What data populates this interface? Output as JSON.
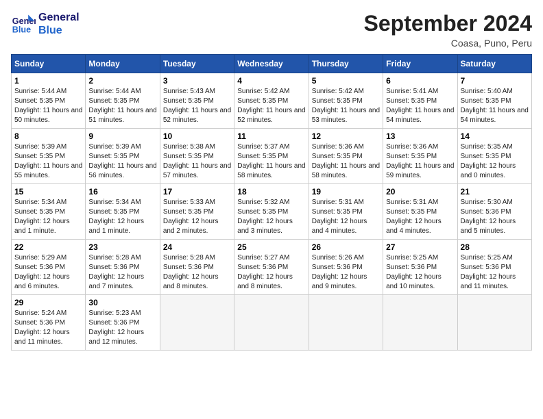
{
  "header": {
    "logo_general": "General",
    "logo_blue": "Blue",
    "month_title": "September 2024",
    "location": "Coasa, Puno, Peru"
  },
  "calendar": {
    "days_of_week": [
      "Sunday",
      "Monday",
      "Tuesday",
      "Wednesday",
      "Thursday",
      "Friday",
      "Saturday"
    ],
    "weeks": [
      [
        {
          "day": "1",
          "sunrise": "5:44 AM",
          "sunset": "5:35 PM",
          "daylight": "11 hours and 50 minutes."
        },
        {
          "day": "2",
          "sunrise": "5:44 AM",
          "sunset": "5:35 PM",
          "daylight": "11 hours and 51 minutes."
        },
        {
          "day": "3",
          "sunrise": "5:43 AM",
          "sunset": "5:35 PM",
          "daylight": "11 hours and 52 minutes."
        },
        {
          "day": "4",
          "sunrise": "5:42 AM",
          "sunset": "5:35 PM",
          "daylight": "11 hours and 52 minutes."
        },
        {
          "day": "5",
          "sunrise": "5:42 AM",
          "sunset": "5:35 PM",
          "daylight": "11 hours and 53 minutes."
        },
        {
          "day": "6",
          "sunrise": "5:41 AM",
          "sunset": "5:35 PM",
          "daylight": "11 hours and 54 minutes."
        },
        {
          "day": "7",
          "sunrise": "5:40 AM",
          "sunset": "5:35 PM",
          "daylight": "11 hours and 54 minutes."
        }
      ],
      [
        {
          "day": "8",
          "sunrise": "5:39 AM",
          "sunset": "5:35 PM",
          "daylight": "11 hours and 55 minutes."
        },
        {
          "day": "9",
          "sunrise": "5:39 AM",
          "sunset": "5:35 PM",
          "daylight": "11 hours and 56 minutes."
        },
        {
          "day": "10",
          "sunrise": "5:38 AM",
          "sunset": "5:35 PM",
          "daylight": "11 hours and 57 minutes."
        },
        {
          "day": "11",
          "sunrise": "5:37 AM",
          "sunset": "5:35 PM",
          "daylight": "11 hours and 58 minutes."
        },
        {
          "day": "12",
          "sunrise": "5:36 AM",
          "sunset": "5:35 PM",
          "daylight": "11 hours and 58 minutes."
        },
        {
          "day": "13",
          "sunrise": "5:36 AM",
          "sunset": "5:35 PM",
          "daylight": "11 hours and 59 minutes."
        },
        {
          "day": "14",
          "sunrise": "5:35 AM",
          "sunset": "5:35 PM",
          "daylight": "12 hours and 0 minutes."
        }
      ],
      [
        {
          "day": "15",
          "sunrise": "5:34 AM",
          "sunset": "5:35 PM",
          "daylight": "12 hours and 1 minute."
        },
        {
          "day": "16",
          "sunrise": "5:34 AM",
          "sunset": "5:35 PM",
          "daylight": "12 hours and 1 minute."
        },
        {
          "day": "17",
          "sunrise": "5:33 AM",
          "sunset": "5:35 PM",
          "daylight": "12 hours and 2 minutes."
        },
        {
          "day": "18",
          "sunrise": "5:32 AM",
          "sunset": "5:35 PM",
          "daylight": "12 hours and 3 minutes."
        },
        {
          "day": "19",
          "sunrise": "5:31 AM",
          "sunset": "5:35 PM",
          "daylight": "12 hours and 4 minutes."
        },
        {
          "day": "20",
          "sunrise": "5:31 AM",
          "sunset": "5:35 PM",
          "daylight": "12 hours and 4 minutes."
        },
        {
          "day": "21",
          "sunrise": "5:30 AM",
          "sunset": "5:36 PM",
          "daylight": "12 hours and 5 minutes."
        }
      ],
      [
        {
          "day": "22",
          "sunrise": "5:29 AM",
          "sunset": "5:36 PM",
          "daylight": "12 hours and 6 minutes."
        },
        {
          "day": "23",
          "sunrise": "5:28 AM",
          "sunset": "5:36 PM",
          "daylight": "12 hours and 7 minutes."
        },
        {
          "day": "24",
          "sunrise": "5:28 AM",
          "sunset": "5:36 PM",
          "daylight": "12 hours and 8 minutes."
        },
        {
          "day": "25",
          "sunrise": "5:27 AM",
          "sunset": "5:36 PM",
          "daylight": "12 hours and 8 minutes."
        },
        {
          "day": "26",
          "sunrise": "5:26 AM",
          "sunset": "5:36 PM",
          "daylight": "12 hours and 9 minutes."
        },
        {
          "day": "27",
          "sunrise": "5:25 AM",
          "sunset": "5:36 PM",
          "daylight": "12 hours and 10 minutes."
        },
        {
          "day": "28",
          "sunrise": "5:25 AM",
          "sunset": "5:36 PM",
          "daylight": "12 hours and 11 minutes."
        }
      ],
      [
        {
          "day": "29",
          "sunrise": "5:24 AM",
          "sunset": "5:36 PM",
          "daylight": "12 hours and 11 minutes."
        },
        {
          "day": "30",
          "sunrise": "5:23 AM",
          "sunset": "5:36 PM",
          "daylight": "12 hours and 12 minutes."
        },
        null,
        null,
        null,
        null,
        null
      ]
    ]
  }
}
